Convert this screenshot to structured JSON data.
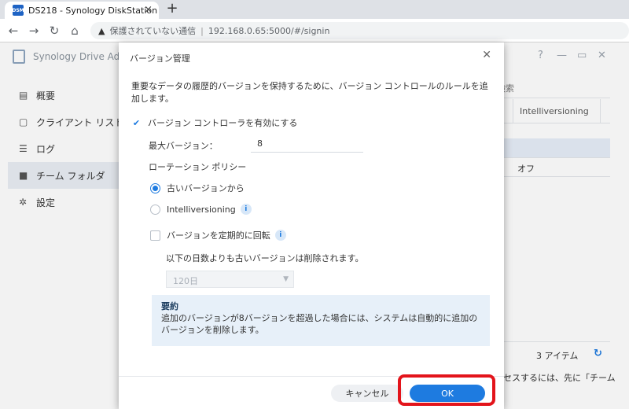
{
  "browser": {
    "tab_title": "DS218 - Synology DiskStation",
    "favicon_text": "DSM",
    "url_warning": "保護されていない通信",
    "url": "192.168.0.65:5000/#/signin"
  },
  "app": {
    "title": "Synology Drive Adm",
    "sidebar": [
      {
        "label": "概要",
        "icon": "overview-icon"
      },
      {
        "label": "クライアント リスト",
        "icon": "client-list-icon"
      },
      {
        "label": "ログ",
        "icon": "log-icon"
      },
      {
        "label": "チーム フォルダ",
        "icon": "team-folder-icon"
      },
      {
        "label": "設定",
        "icon": "gear-icon"
      }
    ],
    "bg_header": "検索",
    "bg_column": "Intelliversioning",
    "bg_cell": "オフ",
    "bg_count": "3 アイテム",
    "bg_footer": "セスするには、先に「チーム"
  },
  "modal": {
    "title": "バージョン管理",
    "description": "重要なデータの履歴的バージョンを保持するために、バージョン コントロールのルールを追加します。",
    "enable_label": "バージョン コントローラを有効にする",
    "max_versions_label": "最大バージョン：",
    "max_versions_value": "8",
    "rotation_label": "ローテーション ポリシー",
    "radio_oldest": "古いバージョンから",
    "radio_intelli": "Intelliversioning",
    "periodic_label": "バージョンを定期的に回転",
    "periodic_note": "以下の日数よりも古いバージョンは削除されます。",
    "periodic_select": "120日",
    "summary_title": "要約",
    "summary_text": "追加のバージョンが8バージョンを超過した場合には、システムは自動的に追加のバージョンを削除します。",
    "cancel_label": "キャンセル",
    "ok_label": "OK"
  }
}
